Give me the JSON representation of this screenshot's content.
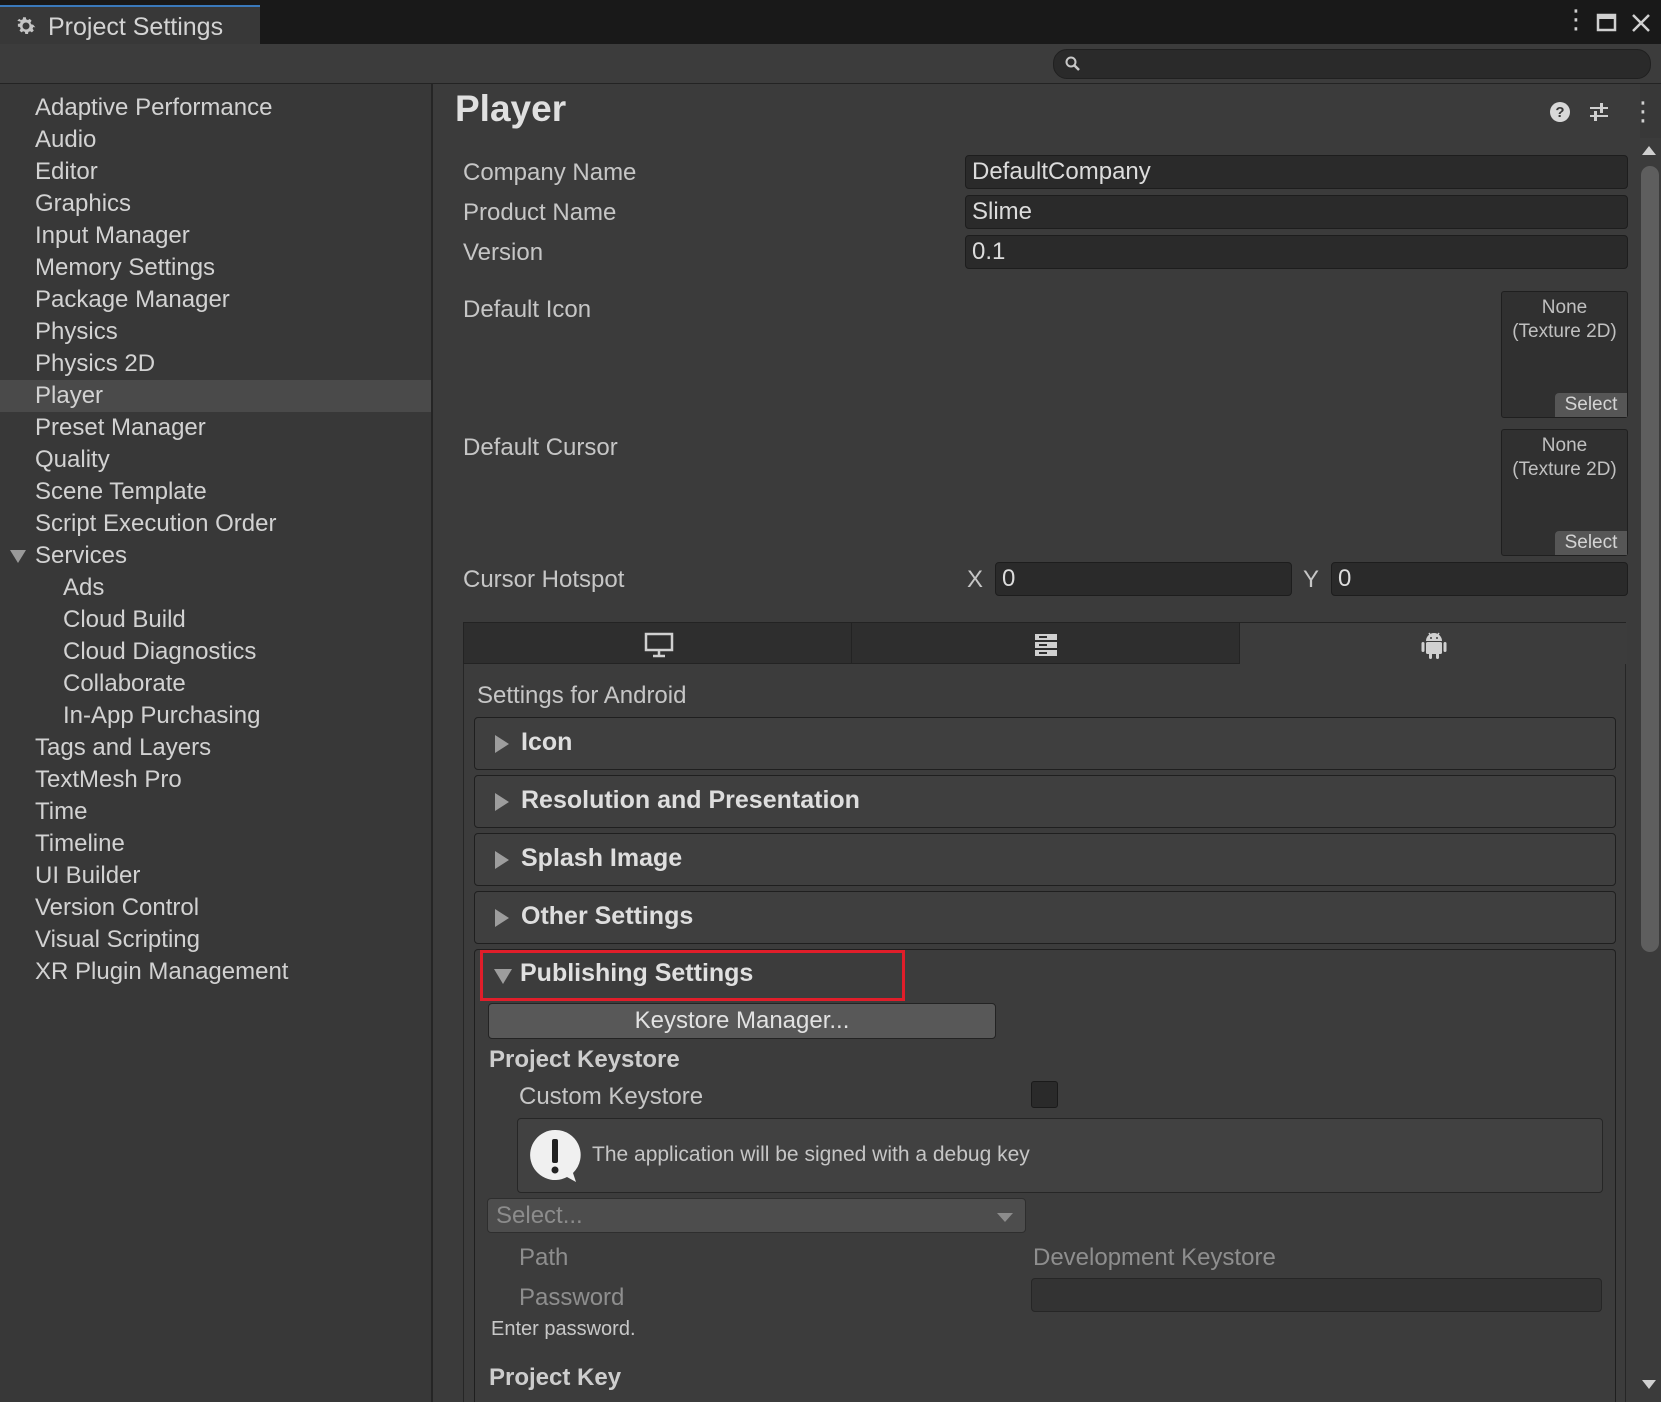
{
  "window": {
    "title": "Project Settings",
    "search_placeholder": ""
  },
  "sidebar": {
    "items": [
      {
        "label": "Adaptive Performance"
      },
      {
        "label": "Audio"
      },
      {
        "label": "Editor"
      },
      {
        "label": "Graphics"
      },
      {
        "label": "Input Manager"
      },
      {
        "label": "Memory Settings"
      },
      {
        "label": "Package Manager"
      },
      {
        "label": "Physics"
      },
      {
        "label": "Physics 2D"
      },
      {
        "label": "Player",
        "selected": true
      },
      {
        "label": "Preset Manager"
      },
      {
        "label": "Quality"
      },
      {
        "label": "Scene Template"
      },
      {
        "label": "Script Execution Order"
      },
      {
        "label": "Services",
        "expanded": true
      },
      {
        "label": "Ads",
        "child": true
      },
      {
        "label": "Cloud Build",
        "child": true
      },
      {
        "label": "Cloud Diagnostics",
        "child": true
      },
      {
        "label": "Collaborate",
        "child": true
      },
      {
        "label": "In-App Purchasing",
        "child": true
      },
      {
        "label": "Tags and Layers"
      },
      {
        "label": "TextMesh Pro"
      },
      {
        "label": "Time"
      },
      {
        "label": "Timeline"
      },
      {
        "label": "UI Builder"
      },
      {
        "label": "Version Control"
      },
      {
        "label": "Visual Scripting"
      },
      {
        "label": "XR Plugin Management"
      }
    ]
  },
  "player": {
    "title": "Player",
    "company_name_label": "Company Name",
    "company_name_value": "DefaultCompany",
    "product_name_label": "Product Name",
    "product_name_value": "Slime",
    "version_label": "Version",
    "version_value": "0.1",
    "default_icon_label": "Default Icon",
    "default_cursor_label": "Default Cursor",
    "texture_none": "None",
    "texture_type": "(Texture 2D)",
    "select_label": "Select",
    "cursor_hotspot_label": "Cursor Hotspot",
    "x_label": "X",
    "x_value": "0",
    "y_label": "Y",
    "y_value": "0"
  },
  "platform_tabs": [
    {
      "icon": "monitor-icon",
      "active": false
    },
    {
      "icon": "server-icon",
      "active": false
    },
    {
      "icon": "android-icon",
      "active": true
    }
  ],
  "android": {
    "settings_label": "Settings for Android",
    "sections": [
      {
        "title": "Icon"
      },
      {
        "title": "Resolution and Presentation"
      },
      {
        "title": "Splash Image"
      },
      {
        "title": "Other Settings"
      }
    ],
    "publishing": {
      "title": "Publishing Settings",
      "keystore_manager_button": "Keystore Manager...",
      "project_keystore_label": "Project Keystore",
      "custom_keystore_label": "Custom Keystore",
      "custom_keystore_checked": false,
      "help_message": "The application will be signed with a debug key",
      "select_placeholder": "Select...",
      "path_label": "Path",
      "path_value": "Development Keystore",
      "password_label": "Password",
      "password_hint": "Enter password.",
      "project_key_label": "Project Key"
    }
  },
  "colors": {
    "highlight": "#e01e2a",
    "accent": "#3a79bb"
  }
}
